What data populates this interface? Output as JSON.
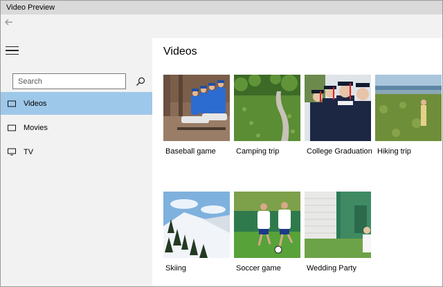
{
  "window": {
    "title": "Video Preview"
  },
  "sidebar": {
    "search": {
      "placeholder": "Search"
    },
    "items": [
      {
        "label": "Videos",
        "icon": "video-icon",
        "selected": true
      },
      {
        "label": "Movies",
        "icon": "movie-icon",
        "selected": false
      },
      {
        "label": "TV",
        "icon": "tv-icon",
        "selected": false
      }
    ]
  },
  "main": {
    "title": "Videos",
    "videos": [
      {
        "label": "Baseball game"
      },
      {
        "label": "Camping trip"
      },
      {
        "label": "College Graduation"
      },
      {
        "label": "Hiking trip"
      },
      {
        "label": "Skiing"
      },
      {
        "label": "Soccer game"
      },
      {
        "label": "Wedding Party"
      }
    ]
  },
  "colors": {
    "selected_nav": "#9ec8ea",
    "sidebar_bg": "#f2f2f2",
    "titlebar_bg": "#d9d9d9"
  }
}
